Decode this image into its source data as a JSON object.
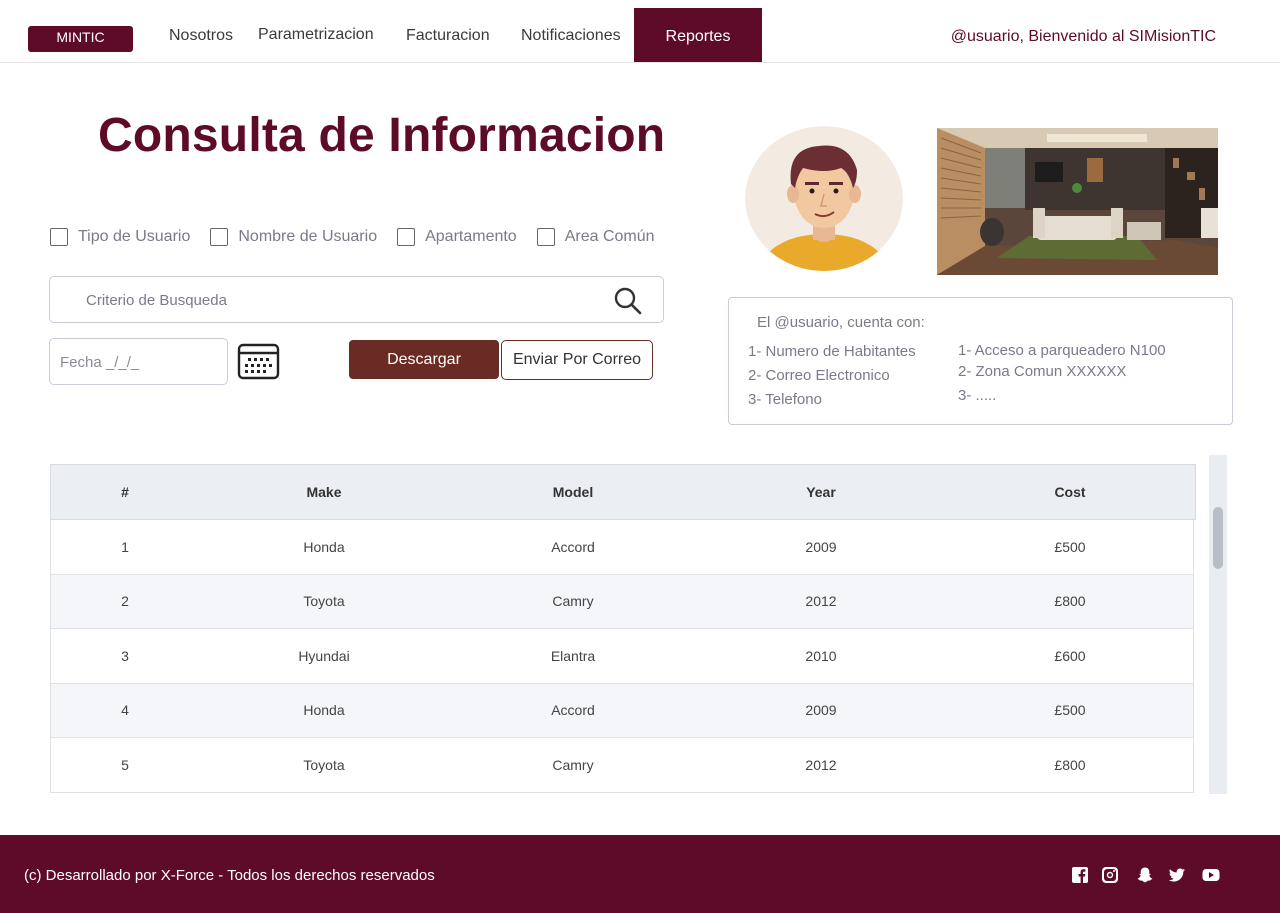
{
  "nav": {
    "brand": "MINTIC",
    "items": [
      "Nosotros",
      "Parametrizacion",
      "Facturacion",
      "Notificaciones"
    ],
    "active": "Reportes",
    "welcome": "@usuario, Bienvenido al SIMisionTIC"
  },
  "page": {
    "title": "Consulta de Informacion"
  },
  "filters": [
    "Tipo de Usuario",
    "Nombre de Usuario",
    "Apartamento",
    "Area Común"
  ],
  "search": {
    "placeholder": "Criterio de Busqueda"
  },
  "date": {
    "placeholder": "Fecha _/_/_"
  },
  "buttons": {
    "download": "Descargar",
    "email": "Enviar Por Correo"
  },
  "info": {
    "header": "El @usuario, cuenta con:",
    "left": [
      "1- Numero de Habitantes",
      "2- Correo Electronico",
      "3- Telefono"
    ],
    "right": [
      "1- Acceso a parqueadero N100",
      "2- Zona Comun XXXXXX",
      "3- ....."
    ]
  },
  "table": {
    "headers": [
      "#",
      "Make",
      "Model",
      "Year",
      "Cost"
    ],
    "rows": [
      [
        "1",
        "Honda",
        "Accord",
        "2009",
        "£500"
      ],
      [
        "2",
        "Toyota",
        "Camry",
        "2012",
        "£800"
      ],
      [
        "3",
        "Hyundai",
        "Elantra",
        "2010",
        "£600"
      ],
      [
        "4",
        "Honda",
        "Accord",
        "2009",
        "£500"
      ],
      [
        "5",
        "Toyota",
        "Camry",
        "2012",
        "£800"
      ]
    ]
  },
  "footer": {
    "copyright": "(c) Desarrollado por X-Force - Todos los derechos reservados",
    "social_icons": [
      "facebook-icon",
      "instagram-icon",
      "snapchat-icon",
      "twitter-icon",
      "youtube-icon"
    ]
  },
  "colors": {
    "brand": "#5e0b2a",
    "button_download": "#6a2b24",
    "table_header_bg": "#ebeef3",
    "row_alt_bg": "#f4f6f9"
  }
}
